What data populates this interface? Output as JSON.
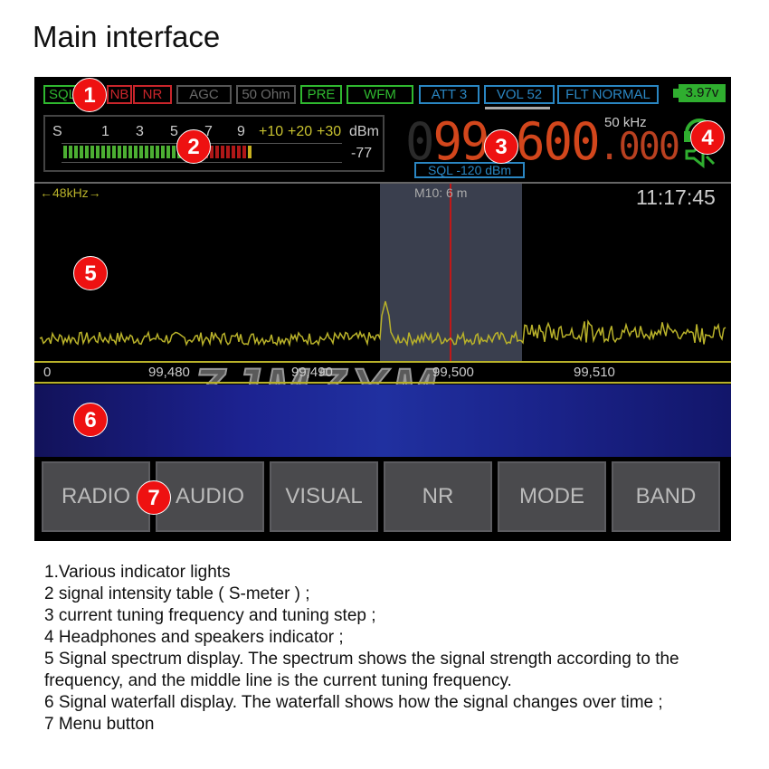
{
  "title": "Main interface",
  "indicators": [
    {
      "label": "SQL",
      "color": "g",
      "w": 42,
      "l": 10
    },
    {
      "label": "NB",
      "color": "r",
      "w": 28,
      "l": 80
    },
    {
      "label": "NR",
      "color": "r",
      "w": 43,
      "l": 109
    },
    {
      "label": "AGC",
      "color": "gr",
      "w": 61,
      "l": 157
    },
    {
      "label": "50 Ohm",
      "color": "gr",
      "w": 66,
      "l": 223
    },
    {
      "label": "PRE",
      "color": "g",
      "w": 46,
      "l": 294
    },
    {
      "label": "WFM",
      "color": "g",
      "w": 74,
      "l": 345
    },
    {
      "label": "ATT 3",
      "color": "b",
      "w": 67,
      "l": 425
    },
    {
      "label": "VOL 52",
      "color": "b",
      "w": 78,
      "l": 497
    },
    {
      "label": "FLT NORMAL",
      "color": "b",
      "w": 112,
      "l": 578
    }
  ],
  "battery": "3.97v",
  "smeter": {
    "scale": [
      "S",
      "1",
      "3",
      "5",
      "7",
      "9"
    ],
    "plus": [
      "+10",
      "+20",
      "+30"
    ],
    "unit": "dBm",
    "value": "-77",
    "level_segments": 35,
    "total_segments": 39
  },
  "frequency": {
    "lead": "0",
    "main": "99.600",
    "frac": ".000",
    "step": "50 kHz"
  },
  "squelch": "SQL -120 dBm",
  "spectrum": {
    "span": "←48kHz→",
    "memory": "M10:  6 m",
    "clock": "11:17:45",
    "ticks": [
      "0",
      "99,480",
      "99,490",
      "99,500",
      "99,510"
    ]
  },
  "watermark": "ZJMZYM",
  "menu": [
    "RADIO",
    "AUDIO",
    "VISUAL",
    "NR",
    "MODE",
    "BAND"
  ],
  "badges": [
    "1",
    "2",
    "3",
    "4",
    "5",
    "6",
    "7"
  ],
  "notes": [
    "1.Various indicator lights",
    "2 signal intensity table ( S-meter ) ;",
    "3 current tuning frequency and tuning step ;",
    "4 Headphones and speakers indicator ;",
    "5 Signal spectrum display. The spectrum shows the signal strength according to the frequency, and the middle line is the current tuning frequency.",
    "6 Signal waterfall display. The waterfall shows how the signal changes over time ;",
    "7 Menu button"
  ]
}
